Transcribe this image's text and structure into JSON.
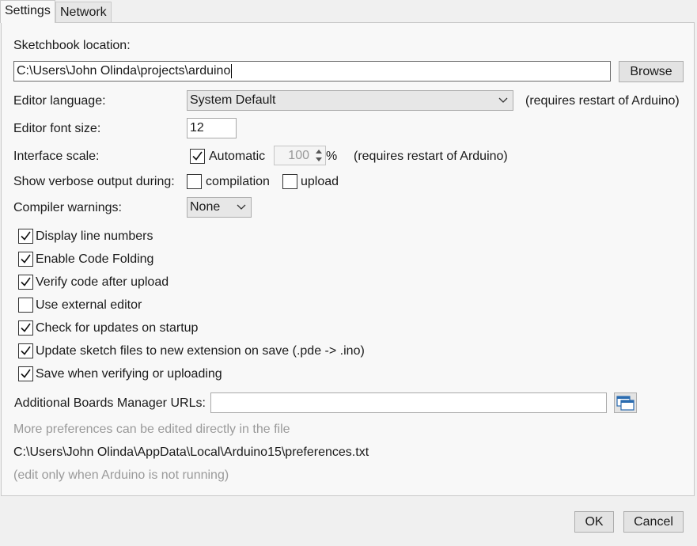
{
  "tabs": [
    {
      "label": "Settings",
      "active": true
    },
    {
      "label": "Network",
      "active": false
    }
  ],
  "sketchbook": {
    "label": "Sketchbook location:",
    "path": "C:\\Users\\John Olinda\\projects\\arduino",
    "browse_label": "Browse"
  },
  "editor_language": {
    "label": "Editor language:",
    "value": "System Default",
    "note": "(requires restart of Arduino)"
  },
  "editor_font_size": {
    "label": "Editor font size:",
    "value": "12"
  },
  "interface_scale": {
    "label": "Interface scale:",
    "automatic_label": "Automatic",
    "automatic_checked": true,
    "value": "100",
    "unit": "%",
    "note": "(requires restart of Arduino)"
  },
  "verbose": {
    "label": "Show verbose output during:",
    "compilation_label": "compilation",
    "compilation_checked": false,
    "upload_label": "upload",
    "upload_checked": false
  },
  "compiler_warnings": {
    "label": "Compiler warnings:",
    "value": "None"
  },
  "options": [
    {
      "label": "Display line numbers",
      "checked": true
    },
    {
      "label": "Enable Code Folding",
      "checked": true
    },
    {
      "label": "Verify code after upload",
      "checked": true
    },
    {
      "label": "Use external editor",
      "checked": false
    },
    {
      "label": "Check for updates on startup",
      "checked": true
    },
    {
      "label": "Update sketch files to new extension on save (.pde -> .ino)",
      "checked": true
    },
    {
      "label": "Save when verifying or uploading",
      "checked": true
    }
  ],
  "boards_manager": {
    "label": "Additional Boards Manager URLs:",
    "value": ""
  },
  "footer": {
    "more_prefs": "More preferences can be edited directly in the file",
    "prefs_path": "C:\\Users\\John Olinda\\AppData\\Local\\Arduino15\\preferences.txt",
    "edit_note": "(edit only when Arduino is not running)"
  },
  "buttons": {
    "ok": "OK",
    "cancel": "Cancel"
  },
  "colors": {
    "background": "#f0f0f0",
    "panel": "#f8f8f8",
    "muted_text": "#9a9a9a",
    "window_icon_blue": "#2b6cb0"
  },
  "icons": {
    "window": "windows-stack-icon"
  }
}
